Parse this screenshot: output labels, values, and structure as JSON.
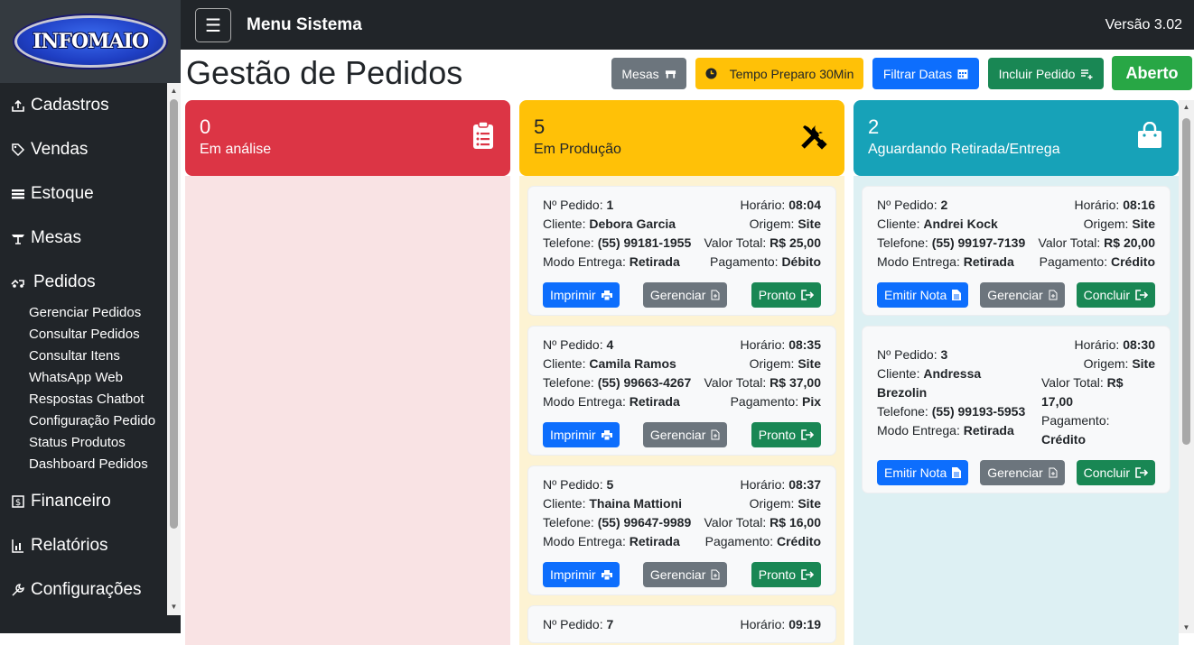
{
  "logo": {
    "text": "INFOMAIO"
  },
  "sidebar": {
    "items": [
      {
        "label": "Cadastros",
        "icon": "upload-box-icon"
      },
      {
        "label": "Vendas",
        "icon": "tag-icon"
      },
      {
        "label": "Estoque",
        "icon": "list-icon"
      },
      {
        "label": "Mesas",
        "icon": "table-icon"
      },
      {
        "label": "Pedidos",
        "icon": "order-icon"
      }
    ],
    "submenu": [
      "Gerenciar Pedidos",
      "Consultar Pedidos",
      "Consultar Itens",
      "WhatsApp Web",
      "Respostas Chatbot",
      "Configuração Pedido",
      "Status Produtos",
      "Dashboard Pedidos"
    ],
    "items_after": [
      {
        "label": "Financeiro",
        "icon": "money-icon"
      },
      {
        "label": "Relatórios",
        "icon": "report-icon"
      },
      {
        "label": "Configurações",
        "icon": "wrench-icon"
      }
    ]
  },
  "topbar": {
    "menu_icon": "☰",
    "title": "Menu Sistema",
    "version": "Versão 3.02"
  },
  "page": {
    "title": "Gestão de Pedidos"
  },
  "toolbar": {
    "mesas": "Mesas",
    "tempo": "Tempo Preparo 30Min",
    "filtrar": "Filtrar Datas",
    "incluir": "Incluir Pedido",
    "status": "Aberto"
  },
  "colors": {
    "red": "#dc3545",
    "yellow": "#ffc107",
    "teal": "#17a2b8",
    "blue": "#0d6efd",
    "gray": "#6c757d",
    "green": "#198754",
    "success": "#28a745"
  },
  "labels": {
    "pedido": "Nº Pedido:",
    "horario": "Horário:",
    "cliente": "Cliente:",
    "origem": "Origem:",
    "telefone": "Telefone:",
    "valor": "Valor Total:",
    "modo": "Modo Entrega:",
    "pagamento": "Pagamento:",
    "imprimir": "Imprimir",
    "gerenciar": "Gerenciar",
    "pronto": "Pronto",
    "emitir": "Emitir Nota",
    "concluir": "Concluir"
  },
  "columns": {
    "analise": {
      "count": "0",
      "label": "Em análise"
    },
    "producao": {
      "count": "5",
      "label": "Em Produção",
      "orders": [
        {
          "num": "1",
          "hora": "08:04",
          "cliente": "Debora Garcia",
          "origem": "Site",
          "telefone": "(55) 99181-1955",
          "valor": "R$ 25,00",
          "modo": "Retirada",
          "pagamento": "Débito"
        },
        {
          "num": "4",
          "hora": "08:35",
          "cliente": "Camila Ramos",
          "origem": "Site",
          "telefone": "(55) 99663-4267",
          "valor": "R$ 37,00",
          "modo": "Retirada",
          "pagamento": "Pix"
        },
        {
          "num": "5",
          "hora": "08:37",
          "cliente": "Thaina Mattioni",
          "origem": "Site",
          "telefone": "(55) 99647-9989",
          "valor": "R$ 16,00",
          "modo": "Retirada",
          "pagamento": "Crédito"
        },
        {
          "num": "7",
          "hora": "09:19"
        }
      ]
    },
    "retirada": {
      "count": "2",
      "label": "Aguardando Retirada/Entrega",
      "orders": [
        {
          "num": "2",
          "hora": "08:16",
          "cliente": "Andrei Kock",
          "origem": "Site",
          "telefone": "(55) 99197-7139",
          "valor": "R$ 20,00",
          "modo": "Retirada",
          "pagamento": "Crédito"
        },
        {
          "num": "3",
          "hora": "08:30",
          "cliente_a": "Andressa",
          "cliente_b": "Brezolin",
          "origem": "Site",
          "telefone": "(55) 99193-5953",
          "valor_a": "R$",
          "valor_b": "17,00",
          "modo": "Retirada",
          "pagamento": "Crédito"
        }
      ]
    }
  }
}
